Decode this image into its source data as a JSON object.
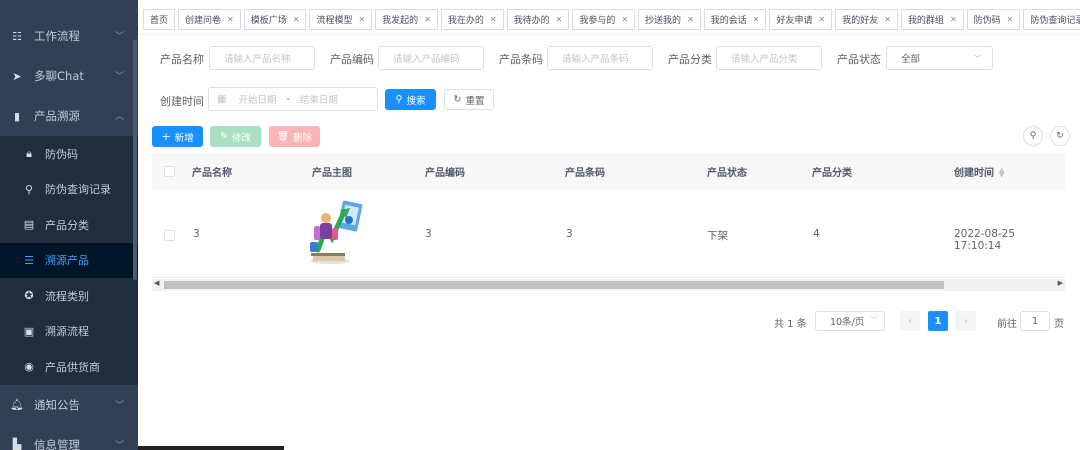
{
  "sidebar": {
    "items": [
      {
        "label": "工作流程",
        "icon": "workflow-icon"
      },
      {
        "label": "多聊Chat",
        "icon": "send-icon"
      },
      {
        "label": "产品溯源",
        "icon": "book-icon"
      }
    ],
    "submenu": [
      {
        "label": "防伪码",
        "icon": "lock-icon"
      },
      {
        "label": "防伪查询记录",
        "icon": "search-icon"
      },
      {
        "label": "产品分类",
        "icon": "document-icon"
      },
      {
        "label": "溯源产品",
        "icon": "sliders-icon"
      },
      {
        "label": "流程类别",
        "icon": "circle-icon"
      },
      {
        "label": "溯源流程",
        "icon": "image-icon"
      },
      {
        "label": "产品供货商",
        "icon": "globe-icon"
      }
    ],
    "bottom": [
      {
        "label": "通知公告",
        "icon": "bell-icon"
      },
      {
        "label": "信息管理",
        "icon": "folder-icon"
      }
    ]
  },
  "tags": [
    {
      "label": "首页",
      "closable": false
    },
    {
      "label": "创建问卷",
      "closable": true
    },
    {
      "label": "模板广场",
      "closable": true
    },
    {
      "label": "流程模型",
      "closable": true
    },
    {
      "label": "我发起的",
      "closable": true
    },
    {
      "label": "我在办的",
      "closable": true
    },
    {
      "label": "我待办的",
      "closable": true
    },
    {
      "label": "我参与的",
      "closable": true
    },
    {
      "label": "抄送我的",
      "closable": true
    },
    {
      "label": "我的会话",
      "closable": true
    },
    {
      "label": "好友申请",
      "closable": true
    },
    {
      "label": "我的好友",
      "closable": true
    },
    {
      "label": "我的群组",
      "closable": true
    },
    {
      "label": "防伪码",
      "closable": true
    },
    {
      "label": "防伪查询记录",
      "closable": true
    }
  ],
  "form": {
    "name_label": "产品名称",
    "name_placeholder": "请输入产品名称",
    "code_label": "产品编码",
    "code_placeholder": "请输入产品编码",
    "barcode_label": "产品条码",
    "barcode_placeholder": "请输入产品条码",
    "category_label": "产品分类",
    "category_placeholder": "请输入产品分类",
    "status_label": "产品状态",
    "status_value": "全部",
    "created_label": "创建时间",
    "start_placeholder": "开始日期",
    "range_sep": "-",
    "end_placeholder": "结束日期",
    "search_label": "搜索",
    "reset_label": "重置"
  },
  "toolbar": {
    "add_label": "新增",
    "edit_label": "修改",
    "delete_label": "删除"
  },
  "table": {
    "headers": [
      "产品名称",
      "产品主图",
      "产品编码",
      "产品条码",
      "产品状态",
      "产品分类",
      "创建时间"
    ],
    "rows": [
      {
        "name": "3",
        "code": "3",
        "barcode": "3",
        "status": "下架",
        "category": "4",
        "created": "2022-08-25 17:10:14"
      }
    ]
  },
  "pagination": {
    "total": "共 1 条",
    "page_size": "10条/页",
    "current": "1",
    "goto_label": "前往",
    "goto_value": "1",
    "goto_suffix": "页"
  }
}
